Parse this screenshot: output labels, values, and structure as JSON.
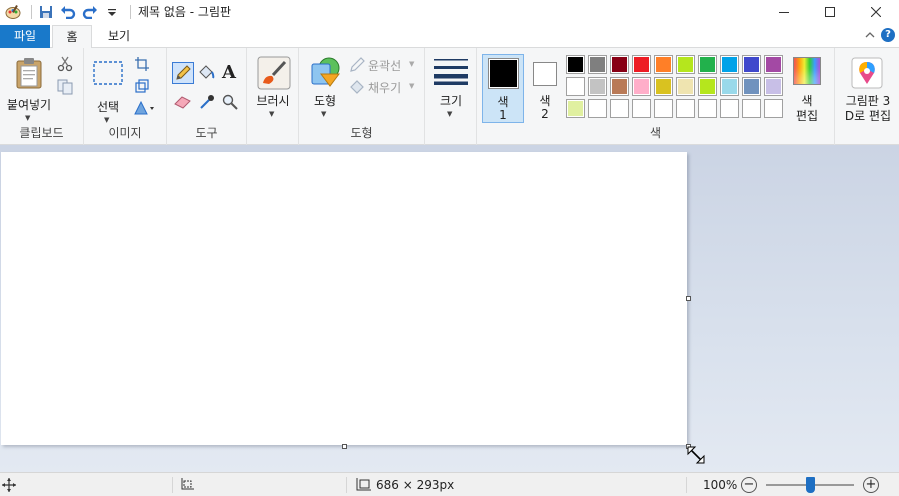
{
  "window": {
    "title": "제목 없음 - 그림판",
    "controls": {
      "minimize": "─",
      "maximize": "☐",
      "close": "✕"
    }
  },
  "tabs": [
    {
      "label": "파일"
    },
    {
      "label": "홈"
    },
    {
      "label": "보기"
    }
  ],
  "ribbon": {
    "clipboard": {
      "paste_label": "붙여넣기",
      "group_label": "클립보드"
    },
    "image": {
      "select_label": "선택",
      "group_label": "이미지"
    },
    "tools": {
      "group_label": "도구",
      "text_glyph": "A"
    },
    "brush": {
      "label": "브러시"
    },
    "shapes": {
      "shapes_label": "도형",
      "outline_label": "윤곽선",
      "fill_label": "채우기",
      "group_label": "도형"
    },
    "size": {
      "label": "크기"
    },
    "colors": {
      "color1_label": "색",
      "color1_num": "1",
      "color2_label": "색",
      "color2_num": "2",
      "edit_label_1": "색",
      "edit_label_2": "편집",
      "group_label": "색",
      "color1": "#000000",
      "color2": "#ffffff",
      "palette_row1": [
        "#000000",
        "#7f7f7f",
        "#880015",
        "#ed1c24",
        "#ff7f27",
        "#b5e61d",
        "#22b14c",
        "#00a2e8",
        "#3f48cc",
        "#a349a4"
      ],
      "palette_row2": [
        "#ffffff",
        "#c3c3c3",
        "#b97a57",
        "#ffaec9",
        "#d9c220",
        "#efe4b0",
        "#b5e61d",
        "#99d9ea",
        "#7092be",
        "#c8bfe7"
      ],
      "palette_row3": [
        "#e0f0a0",
        "#ffffff",
        "#ffffff",
        "#ffffff",
        "#ffffff",
        "#ffffff",
        "#ffffff",
        "#ffffff",
        "#ffffff",
        "#ffffff"
      ]
    },
    "paint3d": {
      "label_1": "그림판 3",
      "label_2": "D로 편집"
    }
  },
  "status": {
    "canvas_size": "686 × 293px",
    "zoom": "100%",
    "zoom_minus": "−",
    "zoom_plus": "+",
    "zoom_level": 0.5
  }
}
